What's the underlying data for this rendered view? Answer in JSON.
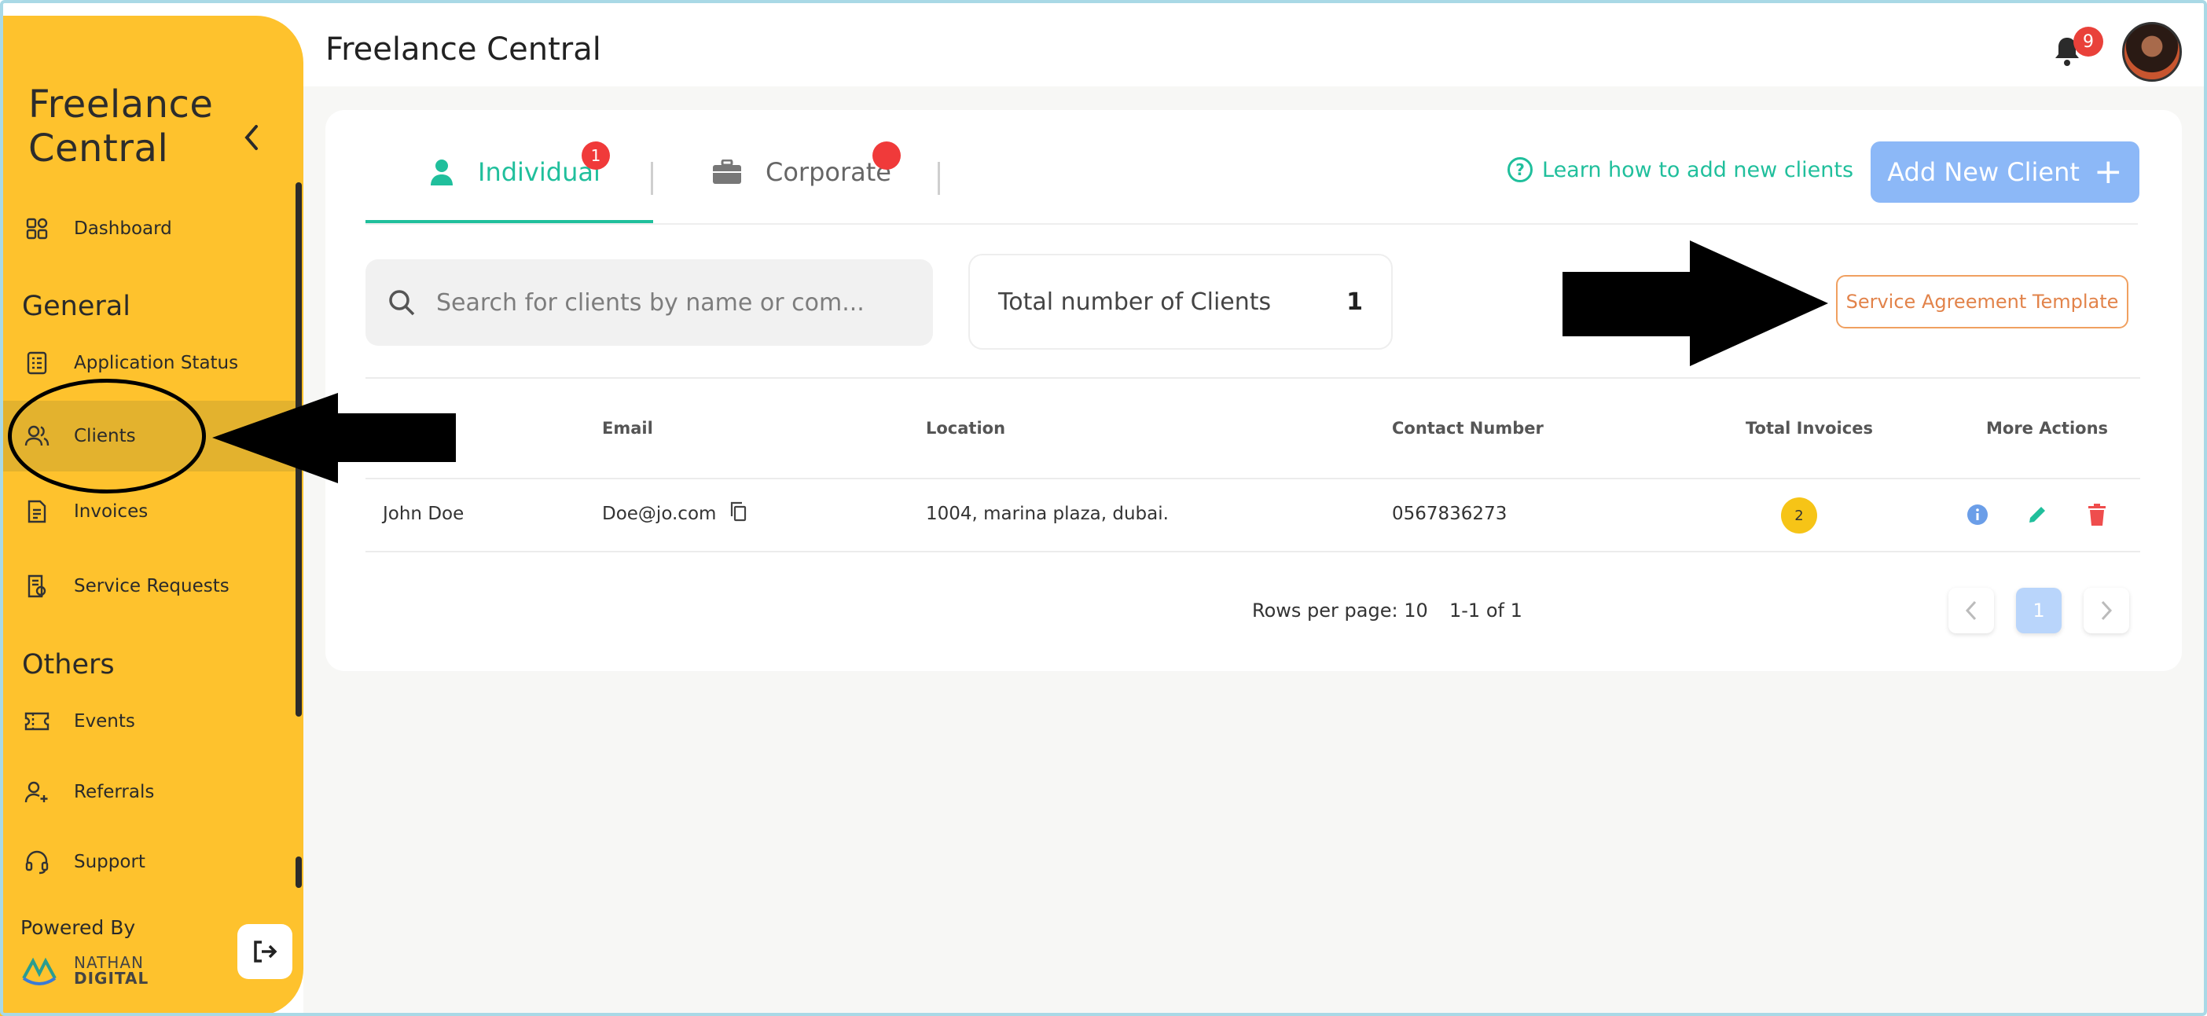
{
  "app": {
    "brand_line1": "Freelance",
    "brand_line2": "Central",
    "page_title": "Freelance Central",
    "notification_count": "9"
  },
  "sidebar": {
    "items": [
      {
        "label": "Dashboard",
        "icon": "dashboard-icon"
      },
      {
        "label": "Application Status",
        "icon": "checklist-icon"
      },
      {
        "label": "Clients",
        "icon": "users-icon",
        "active": true
      },
      {
        "label": "Invoices",
        "icon": "invoice-icon"
      },
      {
        "label": "Service Requests",
        "icon": "service-request-icon"
      },
      {
        "label": "Events",
        "icon": "ticket-icon"
      },
      {
        "label": "Referrals",
        "icon": "user-plus-icon"
      },
      {
        "label": "Support",
        "icon": "headset-icon"
      }
    ],
    "section_general": "General",
    "section_others": "Others",
    "powered_by": "Powered By",
    "company_line1": "NATHAN",
    "company_line2": "DIGITAL"
  },
  "tabs": [
    {
      "label": "Individual",
      "badge": "1",
      "active": true
    },
    {
      "label": "Corporate",
      "badge": ""
    }
  ],
  "toolbar": {
    "learn_link": "Learn how to add new clients",
    "add_button": "Add New Client",
    "search_placeholder": "Search for clients by name or com...",
    "total_label": "Total number of Clients",
    "total_value": "1",
    "service_agreement_button": "Service Agreement Template"
  },
  "table": {
    "headers": [
      "Email",
      "Location",
      "Contact Number",
      "Total Invoices",
      "More Actions"
    ],
    "rows": [
      {
        "name": "John Doe",
        "email": "Doe@jo.com",
        "location": "1004, marina plaza, dubai.",
        "contact": "0567836273",
        "total_invoices": "2"
      }
    ]
  },
  "pagination": {
    "rows_per_page": "Rows per page: 10",
    "range": "1-1 of 1",
    "current_page": "1"
  },
  "colors": {
    "sidebar": "#FEC22D",
    "accent": "#20BF9C",
    "primary_button": "#8CB8F7",
    "badge_red": "#F03A3A",
    "outline_orange": "#E2834A"
  }
}
